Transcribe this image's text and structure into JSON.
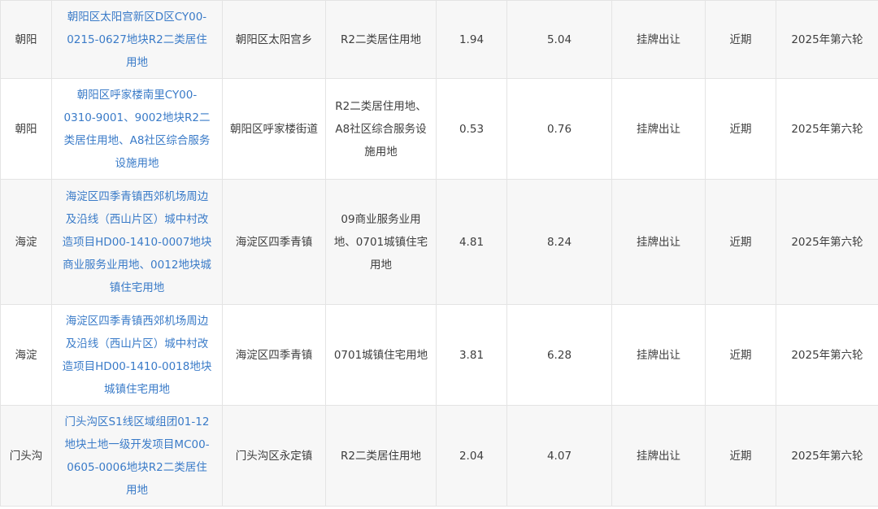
{
  "rows": [
    {
      "district": "朝阳",
      "name": "朝阳区太阳宫新区D区CY00-0215-0627地块R2二类居住用地",
      "location": "朝阳区太阳宫乡",
      "use": "R2二类居住用地",
      "area": "1.94",
      "building_area": "5.04",
      "method": "挂牌出让",
      "timing": "近期",
      "round": "2025年第六轮"
    },
    {
      "district": "朝阳",
      "name": "朝阳区呼家楼南里CY00-0310-9001、9002地块R2二类居住用地、A8社区综合服务设施用地",
      "location": "朝阳区呼家楼街道",
      "use": "R2二类居住用地、A8社区综合服务设施用地",
      "area": "0.53",
      "building_area": "0.76",
      "method": "挂牌出让",
      "timing": "近期",
      "round": "2025年第六轮"
    },
    {
      "district": "海淀",
      "name": "海淀区四季青镇西郊机场周边及沿线（西山片区）城中村改造项目HD00-1410-0007地块商业服务业用地、0012地块城镇住宅用地",
      "location": "海淀区四季青镇",
      "use": "09商业服务业用地、0701城镇住宅用地",
      "area": "4.81",
      "building_area": "8.24",
      "method": "挂牌出让",
      "timing": "近期",
      "round": "2025年第六轮"
    },
    {
      "district": "海淀",
      "name": "海淀区四季青镇西郊机场周边及沿线（西山片区）城中村改造项目HD00-1410-0018地块城镇住宅用地",
      "location": "海淀区四季青镇",
      "use": "0701城镇住宅用地",
      "area": "3.81",
      "building_area": "6.28",
      "method": "挂牌出让",
      "timing": "近期",
      "round": "2025年第六轮"
    },
    {
      "district": "门头沟",
      "name": "门头沟区S1线区域组团01-12地块土地一级开发项目MC00-0605-0006地块R2二类居住用地",
      "location": "门头沟区永定镇",
      "use": "R2二类居住用地",
      "area": "2.04",
      "building_area": "4.07",
      "method": "挂牌出让",
      "timing": "近期",
      "round": "2025年第六轮"
    }
  ]
}
